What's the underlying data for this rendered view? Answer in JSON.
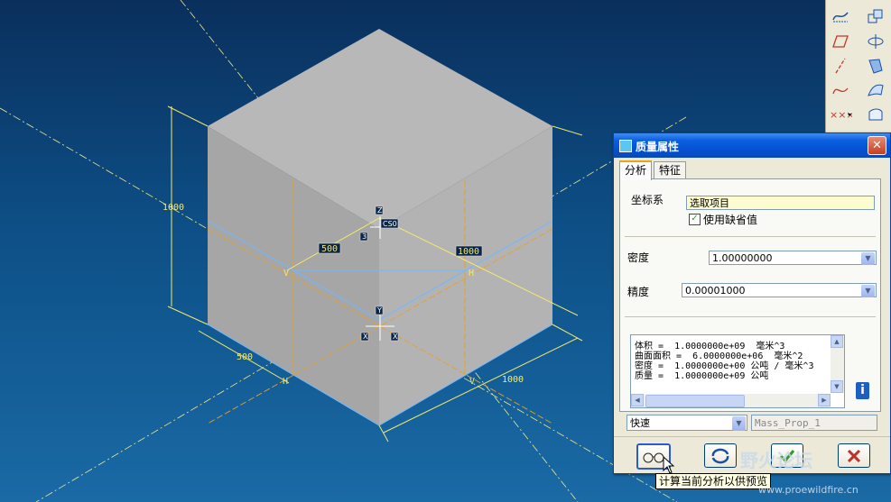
{
  "viewport": {
    "dimensions": {
      "height": "1000",
      "depth_left": "500",
      "width_right": "1000",
      "bottom_left": "500",
      "bottom_right": "1000"
    },
    "axis_labels": {
      "y": "V",
      "h_top": "H",
      "h_bottom": "H",
      "v_bottom": "V"
    },
    "csys_tags": {
      "top": "Z",
      "left": "3",
      "right": "CS0",
      "bottom": "Y",
      "bl": "X",
      "br": "X"
    },
    "colors": {
      "cube_top": "#b8b8b8",
      "cube_left": "#a6a6a6",
      "cube_right": "#b3b3b3",
      "dim": "#f5e96a",
      "datum": "#e8a024",
      "edge_blue": "#6fb8ff"
    }
  },
  "toolbar": {
    "icons": [
      "curve-sketch-icon",
      "scale-icon",
      "plane-icon",
      "revolve-icon",
      "axis-icon",
      "sweep-icon",
      "spline-icon",
      "surface-icon",
      "points-icon",
      "boundary-icon"
    ]
  },
  "dialog": {
    "title": "质量属性",
    "close": "✕",
    "tabs": [
      "分析",
      "特征"
    ],
    "csys_label": "坐标系",
    "csys_value": "选取项目",
    "default_label": "使用缺省值",
    "density_label": "密度",
    "density_value": "1.00000000",
    "precision_label": "精度",
    "precision_value": "0.00001000",
    "results": [
      "体积 =  1.0000000e+09  毫米^3",
      "曲面面积 =  6.0000000e+06  毫米^2",
      "密度 =  1.0000000e+00 公吨 / 毫米^3",
      "质量 =  1.0000000e+09 公吨"
    ],
    "mode_value": "快速",
    "feature_name": "Mass_Prop_1"
  },
  "tooltip": "计算当前分析以供预览",
  "watermark": "野火论坛",
  "watermark_url": "www.proewildfire.cn"
}
